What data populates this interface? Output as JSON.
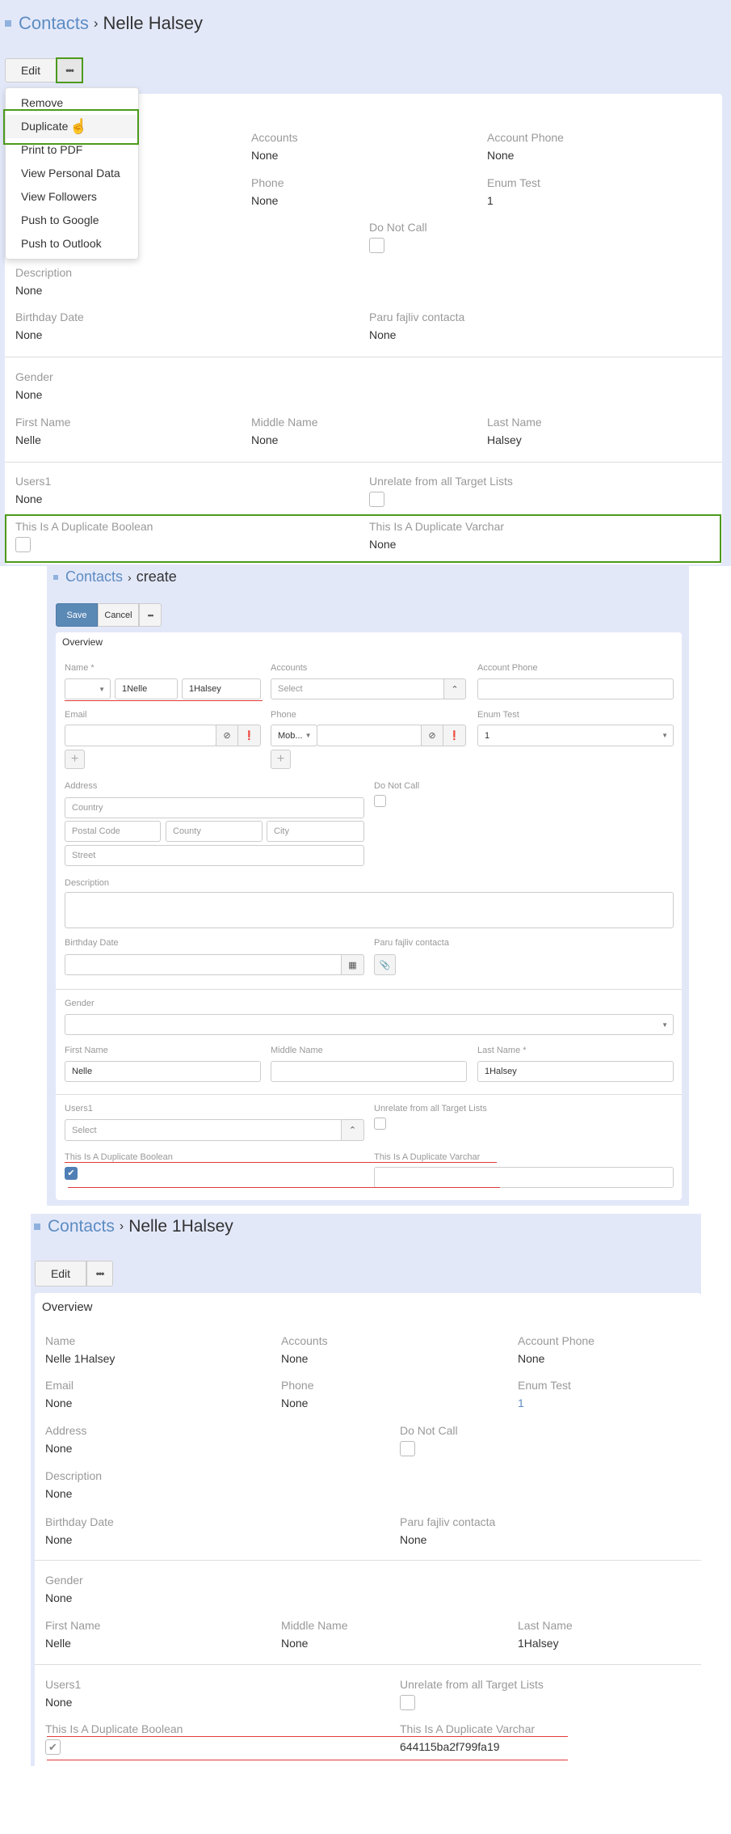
{
  "colors": {
    "background": "#e3e8f9",
    "link": "#5d8cc2",
    "highlight": "#4c9a1c",
    "annotation_line": "#e23a3a",
    "primary_button": "#5b89b6"
  },
  "detail_before": {
    "breadcrumb": {
      "parent": "Contacts",
      "current": "Nelle Halsey"
    },
    "edit_label": "Edit",
    "more_icon": "ellipsis-icon",
    "menu": [
      "Remove",
      "Duplicate",
      "Print to PDF",
      "View Personal Data",
      "View Followers",
      "Push to Google",
      "Push to Outlook"
    ],
    "fields": {
      "accounts": {
        "label": "Accounts",
        "value": "None"
      },
      "account_phone": {
        "label": "Account Phone",
        "value": "None"
      },
      "phone": {
        "label": "Phone",
        "value": "None"
      },
      "enum_test": {
        "label": "Enum Test",
        "value": "1"
      },
      "do_not_call": {
        "label": "Do Not Call",
        "checked": false
      },
      "description": {
        "label": "Description",
        "value": "None"
      },
      "birthday": {
        "label": "Birthday Date",
        "value": "None"
      },
      "paru": {
        "label": "Paru fajliv contacta",
        "value": "None"
      },
      "gender": {
        "label": "Gender",
        "value": "None"
      },
      "first_name": {
        "label": "First Name",
        "value": "Nelle"
      },
      "middle_name": {
        "label": "Middle Name",
        "value": "None"
      },
      "last_name": {
        "label": "Last Name",
        "value": "Halsey"
      },
      "users1": {
        "label": "Users1",
        "value": "None"
      },
      "unrelate": {
        "label": "Unrelate from all Target Lists",
        "checked": false
      },
      "dup_bool": {
        "label": "This Is A Duplicate Boolean",
        "checked": false
      },
      "dup_varchar": {
        "label": "This Is A Duplicate Varchar",
        "value": "None"
      }
    }
  },
  "create": {
    "breadcrumb": {
      "parent": "Contacts",
      "current": "create"
    },
    "save_label": "Save",
    "cancel_label": "Cancel",
    "panel_title": "Overview",
    "fields": {
      "name": {
        "label": "Name *",
        "first": "1Nelle",
        "last": "1Halsey"
      },
      "accounts": {
        "label": "Accounts",
        "placeholder": "Select"
      },
      "account_phone": {
        "label": "Account Phone",
        "value": ""
      },
      "email": {
        "label": "Email",
        "value": ""
      },
      "phone": {
        "label": "Phone",
        "type": "Mob...",
        "value": ""
      },
      "enum_test": {
        "label": "Enum Test",
        "value": "1"
      },
      "address": {
        "label": "Address",
        "country": "Country",
        "postal": "Postal Code",
        "county": "County",
        "city": "City",
        "street": "Street"
      },
      "do_not_call": {
        "label": "Do Not Call",
        "checked": false
      },
      "description": {
        "label": "Description",
        "value": ""
      },
      "birthday": {
        "label": "Birthday Date",
        "value": ""
      },
      "paru": {
        "label": "Paru fajliv contacta"
      },
      "gender": {
        "label": "Gender",
        "value": ""
      },
      "first_name": {
        "label": "First Name",
        "value": "Nelle"
      },
      "middle_name": {
        "label": "Middle Name",
        "value": ""
      },
      "last_name": {
        "label": "Last Name *",
        "value": "1Halsey"
      },
      "users1": {
        "label": "Users1",
        "placeholder": "Select"
      },
      "unrelate": {
        "label": "Unrelate from all Target Lists",
        "checked": false
      },
      "dup_bool": {
        "label": "This Is A Duplicate Boolean",
        "checked": true
      },
      "dup_varchar": {
        "label": "This Is A Duplicate Varchar",
        "value": ""
      }
    }
  },
  "detail_after": {
    "breadcrumb": {
      "parent": "Contacts",
      "current": "Nelle 1Halsey"
    },
    "edit_label": "Edit",
    "panel_title": "Overview",
    "fields": {
      "name": {
        "label": "Name",
        "value": "Nelle 1Halsey"
      },
      "accounts": {
        "label": "Accounts",
        "value": "None"
      },
      "account_phone": {
        "label": "Account Phone",
        "value": "None"
      },
      "email": {
        "label": "Email",
        "value": "None"
      },
      "phone": {
        "label": "Phone",
        "value": "None"
      },
      "enum_test": {
        "label": "Enum Test",
        "value": "1"
      },
      "address": {
        "label": "Address",
        "value": "None"
      },
      "do_not_call": {
        "label": "Do Not Call",
        "checked": false
      },
      "description": {
        "label": "Description",
        "value": "None"
      },
      "birthday": {
        "label": "Birthday Date",
        "value": "None"
      },
      "paru": {
        "label": "Paru fajliv contacta",
        "value": "None"
      },
      "gender": {
        "label": "Gender",
        "value": "None"
      },
      "first_name": {
        "label": "First Name",
        "value": "Nelle"
      },
      "middle_name": {
        "label": "Middle Name",
        "value": "None"
      },
      "last_name": {
        "label": "Last Name",
        "value": "1Halsey"
      },
      "users1": {
        "label": "Users1",
        "value": "None"
      },
      "unrelate": {
        "label": "Unrelate from all Target Lists",
        "checked": false
      },
      "dup_bool": {
        "label": "This Is A Duplicate Boolean",
        "checked": true
      },
      "dup_varchar": {
        "label": "This Is A Duplicate Varchar",
        "value": "644115ba2f799fa19"
      }
    }
  }
}
